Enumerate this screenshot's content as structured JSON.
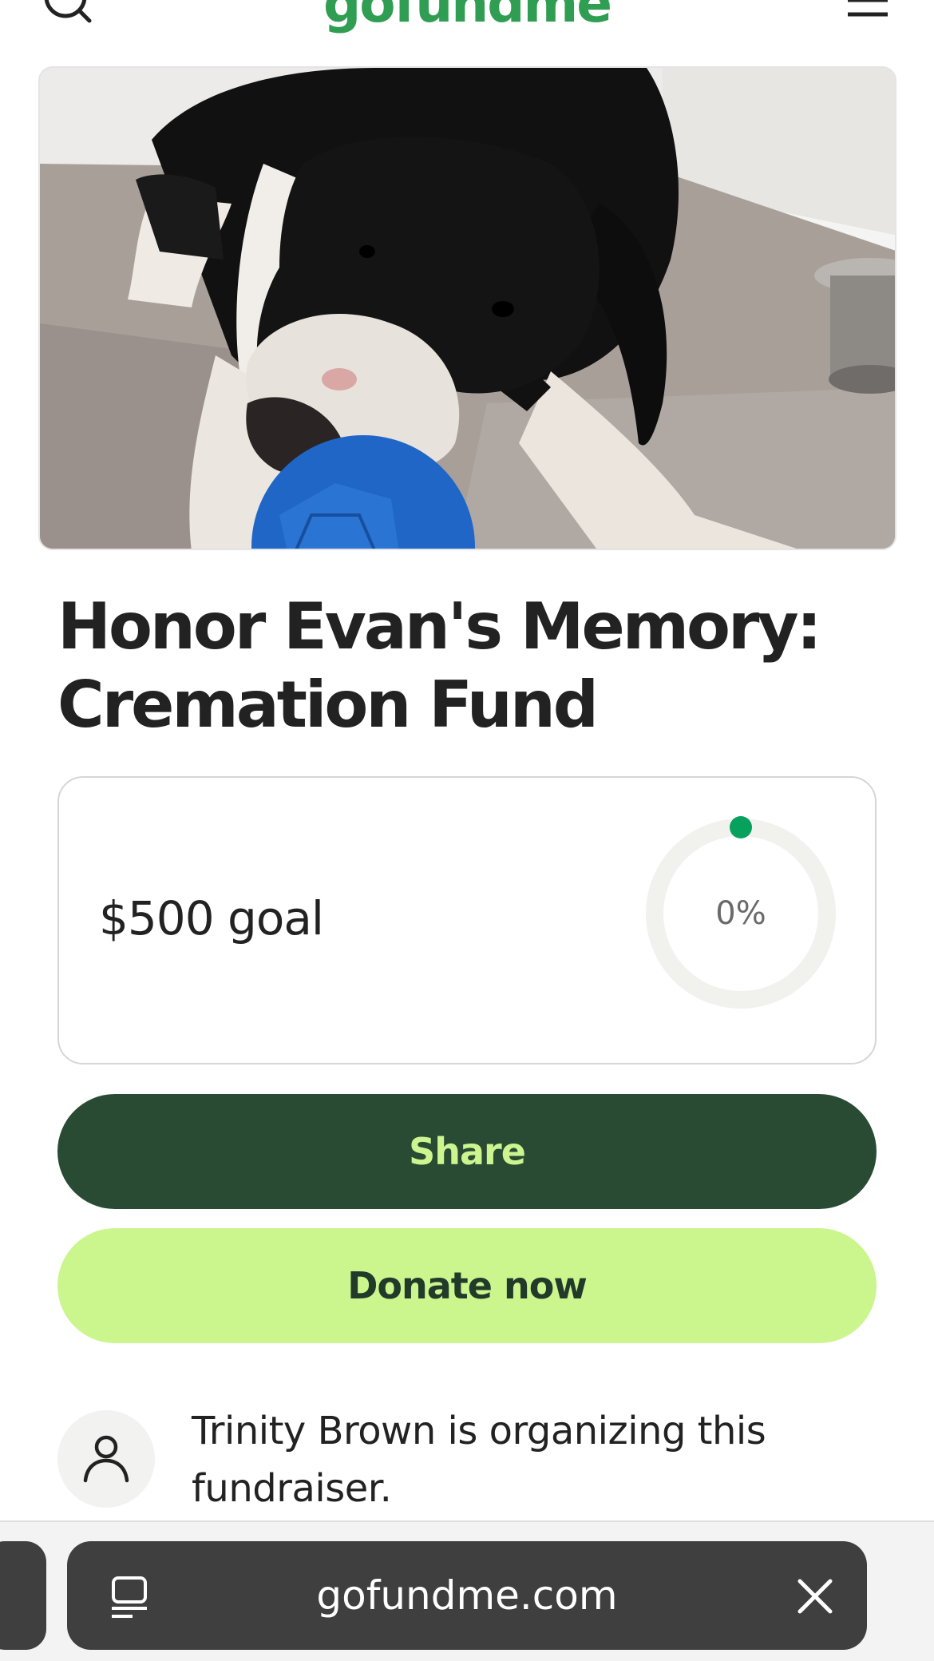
{
  "header": {
    "logo_text": "gofundme",
    "search_icon": "search-icon",
    "menu_icon": "hamburger-menu-icon",
    "brand_color": "#2f9e52"
  },
  "hero": {
    "image": "dog-with-blue-ball-photo"
  },
  "campaign": {
    "title": "Honor Evan's Memory: Cremation Fund",
    "goal_text": "$500 goal",
    "progress_label": "0%",
    "progress_fraction": 0
  },
  "actions": {
    "share_label": "Share",
    "donate_label": "Donate now",
    "share_bg": "#294b33",
    "share_fg": "#cdf58f",
    "donate_bg": "#cbf58d",
    "donate_fg": "#223a2a"
  },
  "organizer": {
    "avatar_icon": "person-icon",
    "text": "Trinity Brown is organizing this fundraiser."
  },
  "browser": {
    "url": "gofundme.com",
    "reader_icon": "reader-mode-icon",
    "close_icon": "close-icon"
  }
}
